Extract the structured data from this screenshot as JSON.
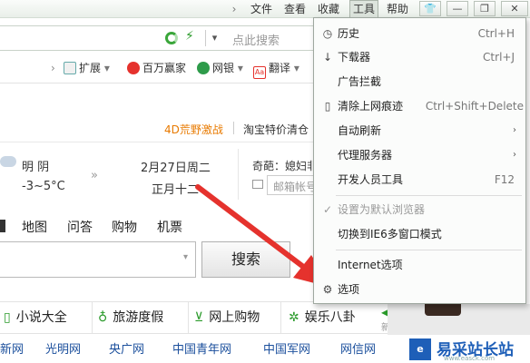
{
  "menubar": {
    "items": [
      "文件",
      "查看",
      "收藏",
      "工具",
      "帮助"
    ],
    "active": "工具"
  },
  "addressbar": {
    "search_placeholder": "点此搜索"
  },
  "toolbar": {
    "items": [
      "扩展",
      "百万赢家",
      "网银",
      "翻译"
    ]
  },
  "promo": {
    "text": "4D荒野激战",
    "item2": "淘宝特价清仓"
  },
  "weather": {
    "condition": "明  阴",
    "temp": "-3~5°C"
  },
  "date": {
    "day": "2月27日周二",
    "lunar": "正月十二"
  },
  "side": {
    "text1": "奇葩：媳妇非",
    "mail_placeholder": "邮箱帐号"
  },
  "nav": {
    "tabs": [
      "地图",
      "问答",
      "购物",
      "机票"
    ]
  },
  "search": {
    "button": "搜索"
  },
  "categories": [
    "小说大全",
    "旅游度假",
    "网上购物",
    "娱乐八卦"
  ],
  "cat_extra": "新",
  "sites": [
    "新网",
    "光明网",
    "央广网",
    "中国青年网",
    "中国军网",
    "网信网"
  ],
  "watermark": {
    "text": "易采站长站",
    "sub": "www.easck.com"
  },
  "menu": {
    "items": [
      {
        "label": "历史",
        "shortcut": "Ctrl+H",
        "icon": "history-icon"
      },
      {
        "label": "下载器",
        "shortcut": "Ctrl+J",
        "icon": "download-icon"
      },
      {
        "label": "广告拦截",
        "shortcut": ""
      },
      {
        "label": "清除上网痕迹",
        "shortcut": "Ctrl+Shift+Delete",
        "icon": "clear-icon"
      },
      {
        "label": "自动刷新",
        "shortcut": "",
        "submenu": true
      },
      {
        "label": "代理服务器",
        "shortcut": "",
        "submenu": true
      },
      {
        "label": "开发人员工具",
        "shortcut": "F12"
      },
      {
        "label": "设置为默认浏览器",
        "shortcut": "",
        "disabled": true,
        "icon": "check-icon"
      },
      {
        "label": "切换到IE6多窗口模式",
        "shortcut": ""
      },
      {
        "label": "Internet选项",
        "shortcut": ""
      },
      {
        "label": "选项",
        "shortcut": "",
        "icon": "gear-icon"
      }
    ]
  },
  "colors": {
    "accent_red": "#e5322d",
    "green": "#2a9a2a",
    "promo_orange": "#e87a00"
  }
}
